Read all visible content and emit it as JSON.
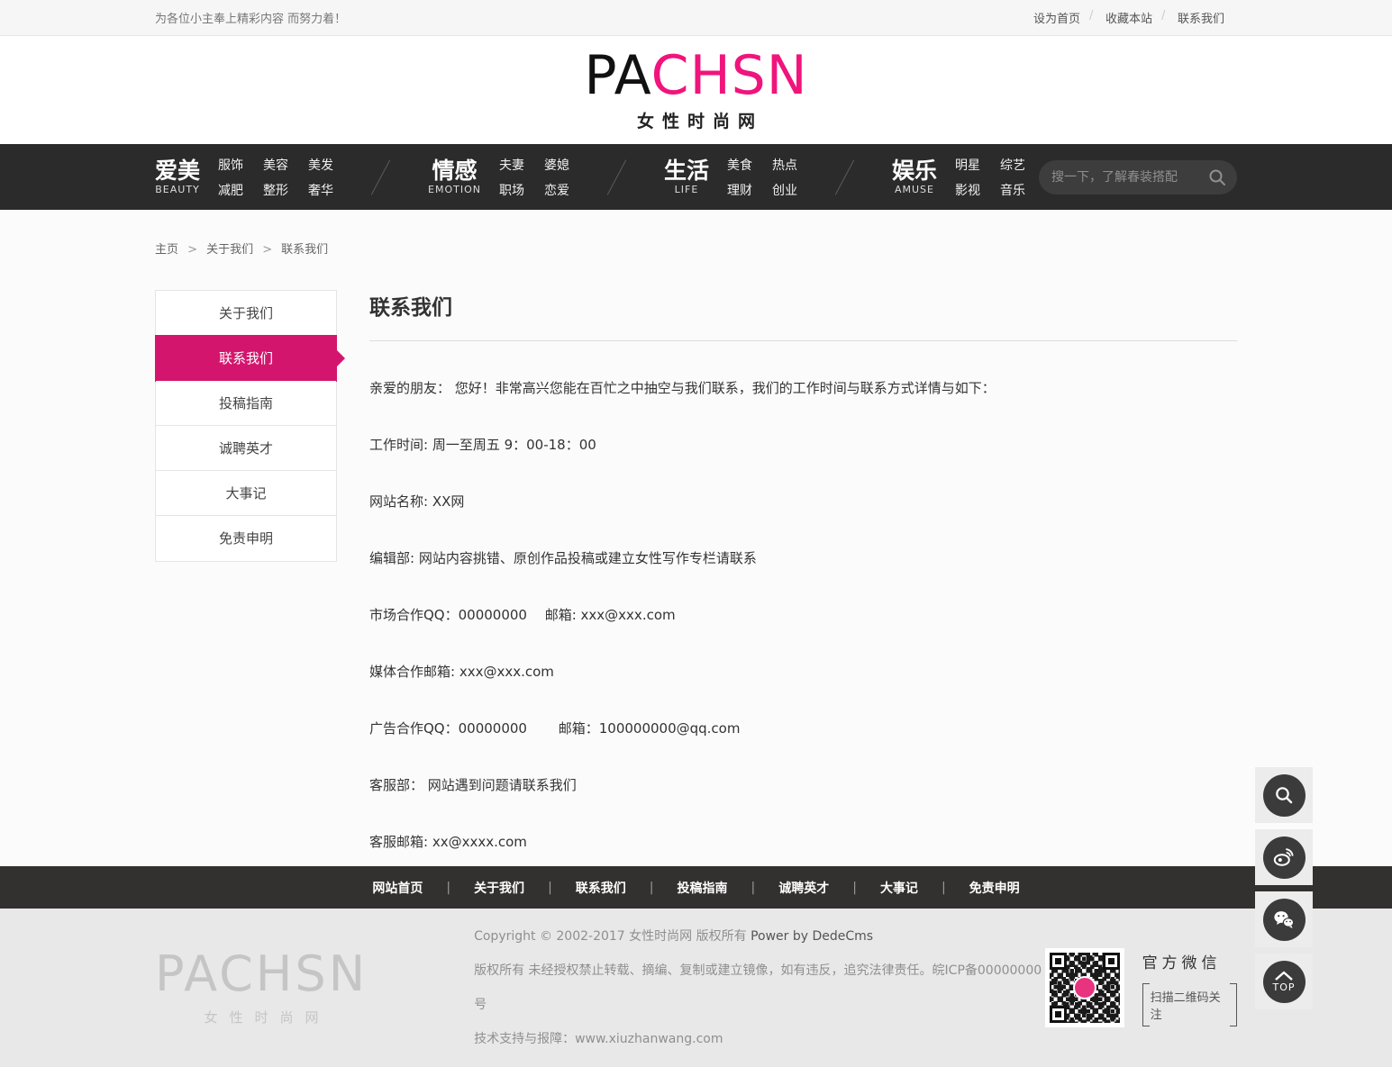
{
  "topbar": {
    "slogan": "为各位小主奉上精彩内容 而努力着！",
    "links": [
      "设为首页",
      "收藏本站",
      "联系我们"
    ]
  },
  "logo": {
    "part1": "PA",
    "part2": "CHSN",
    "subtitle": "女性时尚网"
  },
  "nav": {
    "sections": [
      {
        "title": "爱美",
        "subtitle": "BEAUTY",
        "row1": [
          "服饰",
          "美容",
          "美发"
        ],
        "row2": [
          "减肥",
          "整形",
          "奢华"
        ]
      },
      {
        "title": "情感",
        "subtitle": "EMOTION",
        "row1": [
          "夫妻",
          "婆媳"
        ],
        "row2": [
          "职场",
          "恋爱"
        ]
      },
      {
        "title": "生活",
        "subtitle": "LIFE",
        "row1": [
          "美食",
          "热点"
        ],
        "row2": [
          "理财",
          "创业"
        ]
      },
      {
        "title": "娱乐",
        "subtitle": "AMUSE",
        "row1": [
          "明星",
          "综艺"
        ],
        "row2": [
          "影视",
          "音乐"
        ]
      }
    ],
    "search_placeholder": "搜一下，了解春装搭配"
  },
  "breadcrumb": {
    "items": [
      "主页",
      "关于我们",
      "联系我们"
    ]
  },
  "sidebar": {
    "items": [
      {
        "label": "关于我们"
      },
      {
        "label": "联系我们"
      },
      {
        "label": "投稿指南"
      },
      {
        "label": "诚聘英才"
      },
      {
        "label": "大事记"
      },
      {
        "label": "免责申明"
      }
    ],
    "active_index": 1
  },
  "content": {
    "title": "联系我们",
    "paragraphs": [
      " 亲爱的朋友： 您好！非常高兴您能在百忙之中抽空与我们联系，我们的工作时间与联系方式详情与如下：",
      "工作时间: 周一至周五 9：00-18：00",
      "网站名称: XX网",
      "编辑部: 网站内容挑错、原创作品投稿或建立女性写作专栏请联系",
      "市场合作QQ：00000000　 邮箱: xxx@xxx.com",
      "媒体合作邮箱: xxx@xxx.com",
      "广告合作QQ：00000000　　  邮箱：100000000@qq.com",
      "客服部： 网站遇到问题请联系我们",
      "客服邮箱: xx@xxxx.com"
    ]
  },
  "footer_nav": {
    "items": [
      "网站首页",
      "关于我们",
      "联系我们",
      "投稿指南",
      "诚聘英才",
      "大事记",
      "免责申明"
    ]
  },
  "footer": {
    "logo": "PACHSN",
    "logo_subtitle": "女性时尚网",
    "copyright_prefix": "Copyright © 2002-2017 女性时尚网 版权所有 ",
    "copyright_power": "Power by DedeCms",
    "line2": "版权所有 未经授权禁止转载、摘编、复制或建立镜像，如有违反，追究法律责任。皖ICP备00000000号",
    "line3": "技术支持与报障：www.xiuzhanwang.com",
    "wechat_title": "官方微信",
    "wechat_subtitle": "扫描二维码关注"
  },
  "floating": {
    "top_label": "TOP"
  },
  "colors": {
    "accent_pink": "#d4156e",
    "logo_pink": "#f0147c",
    "nav_bg": "#2b2b2b",
    "footer_bar_bg": "#333030",
    "footer_bg": "#e8e8e8"
  }
}
